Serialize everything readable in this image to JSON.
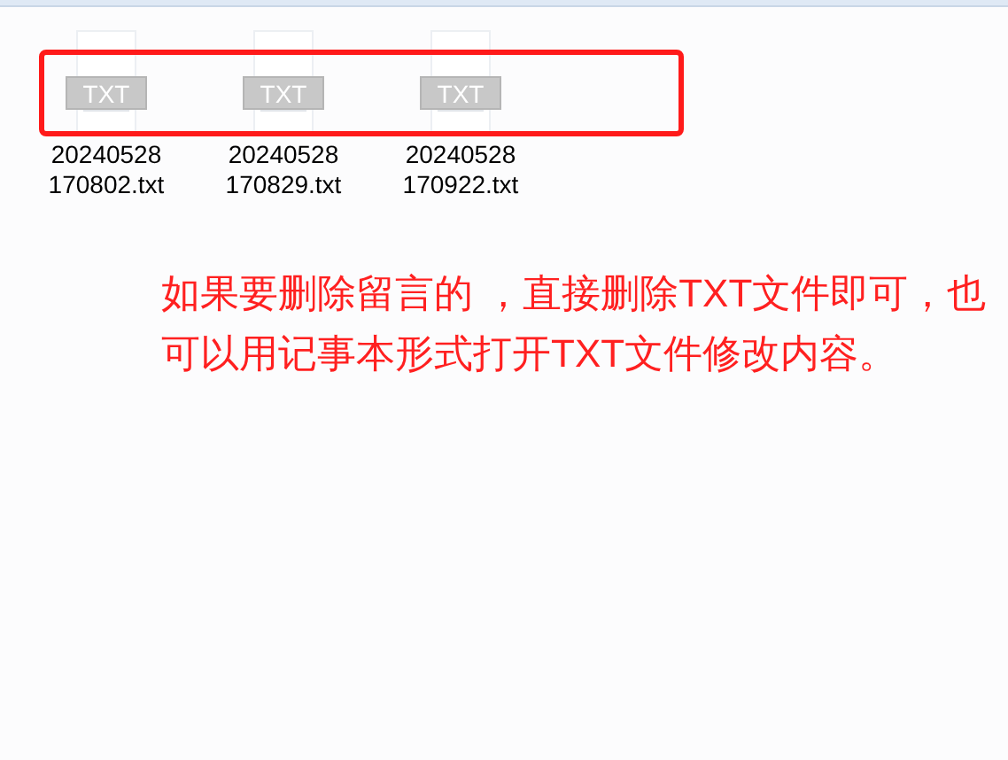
{
  "files": [
    {
      "icon_label": "TXT",
      "name_lines": [
        "20240528",
        "170802.txt"
      ]
    },
    {
      "icon_label": "TXT",
      "name_lines": [
        "20240528",
        "170829.txt"
      ]
    },
    {
      "icon_label": "TXT",
      "name_lines": [
        "20240528",
        "170922.txt"
      ]
    }
  ],
  "annotation": "如果要删除留言的 ，直接删除TXT文件即可，也可以用记事本形式打开TXT文件修改内容。"
}
